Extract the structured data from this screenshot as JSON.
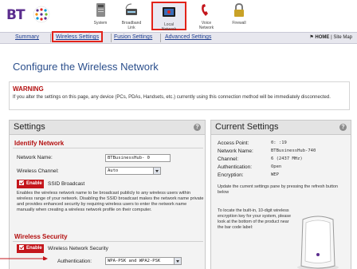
{
  "brand": {
    "name": "BT"
  },
  "nav": {
    "items": [
      {
        "key": "system",
        "label": "System"
      },
      {
        "key": "broadband",
        "label": "Broadband\nLink"
      },
      {
        "key": "local",
        "label": "Local\nNetwork"
      },
      {
        "key": "voice",
        "label": "Voice\nNetwork"
      },
      {
        "key": "firewall",
        "label": "Firewall"
      }
    ],
    "active": "Local Network"
  },
  "subnav": {
    "tabs": [
      "Summary",
      "Wireless Settings",
      "Fusion Settings",
      "Advanced Settings"
    ],
    "active": "Wireless Settings",
    "home": "HOME",
    "sitemap": "Site Map"
  },
  "page": {
    "title": "Configure the Wireless Network"
  },
  "warning": {
    "heading": "WARNING",
    "text": "If you alter the settings on this page, any device (PCs, PDAs, Handsets, etc.) currently using this connection method will be immediately disconnected."
  },
  "settings": {
    "title": "Settings",
    "identify": {
      "heading": "Identify Network",
      "network_name_label": "Network Name:",
      "network_name_value": "BTBusinessHub-  0",
      "channel_label": "Wireless Channel:",
      "channel_value": "Auto",
      "ssid_enable": "Enable",
      "ssid_label": "SSID Broadcast",
      "ssid_text": "Enables the wireless network name to be broadcast publicly to any wireless users within wireless range of your network. Disabling the SSID broadcast makes the network name private and provides enhanced security by requiring wireless users to enter the network name manually when creating a wireless network profile on their computer."
    },
    "security": {
      "heading": "Wireless Security",
      "enable": "Enable",
      "label": "Wireless Network Security",
      "auth_label": "Authentication:",
      "auth_value": "WPA-PSK and WPA2-PSK"
    }
  },
  "current": {
    "title": "Current Settings",
    "rows": [
      {
        "label": "Access Point:",
        "value": "0:       :19"
      },
      {
        "label": "Network Name:",
        "value": "BTBusinessHub-740"
      },
      {
        "label": "Channel:",
        "value": "6 (2437 MHz)"
      },
      {
        "label": "Authentication:",
        "value": "Open"
      },
      {
        "label": "Encryption:",
        "value": "WEP"
      }
    ],
    "refresh_text": "Update the current settings pane by pressing the refresh button below",
    "locate_text": "To locate the built-in, 10-digit wireless encryption key for your system, please look at the bottom of the product near the bar code label:"
  },
  "colors": {
    "accent": "#b41010",
    "brand": "#5b2d8e",
    "link": "#1a3b8f",
    "highlight": "#e2231a"
  }
}
